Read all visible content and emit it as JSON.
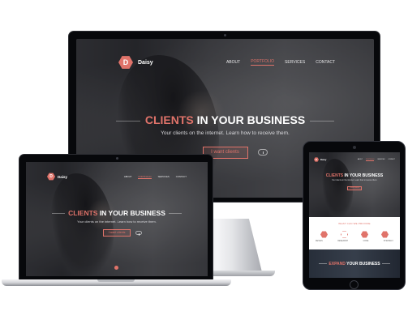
{
  "site": {
    "brand_letter": "D",
    "brand_name": "Daisy",
    "menu": [
      "ABOUT",
      "PORTFOLIO",
      "SERVICES",
      "CONTACT"
    ],
    "active_menu_index": 1,
    "headline_accent": "CLIENTS",
    "headline_rest": " IN YOUR BUSINESS",
    "subline": "Your clients on the internet. Learn how to receive them.",
    "cta_label": "I want clients"
  },
  "tablet": {
    "section_title": "WHAT CAN WE PROVIDE",
    "features": [
      "DESIGN",
      "RESEARCH",
      "CODE",
      "STRATEGY"
    ],
    "bottom_accent": "EXPAND",
    "bottom_rest": " YOUR BUSINESS"
  },
  "colors": {
    "accent": "#e0736a",
    "bezel": "#07080b"
  },
  "icons": [
    "hexagon-logo-icon",
    "scroll-mouse-icon",
    "home-button-icon",
    "camera-icon"
  ]
}
